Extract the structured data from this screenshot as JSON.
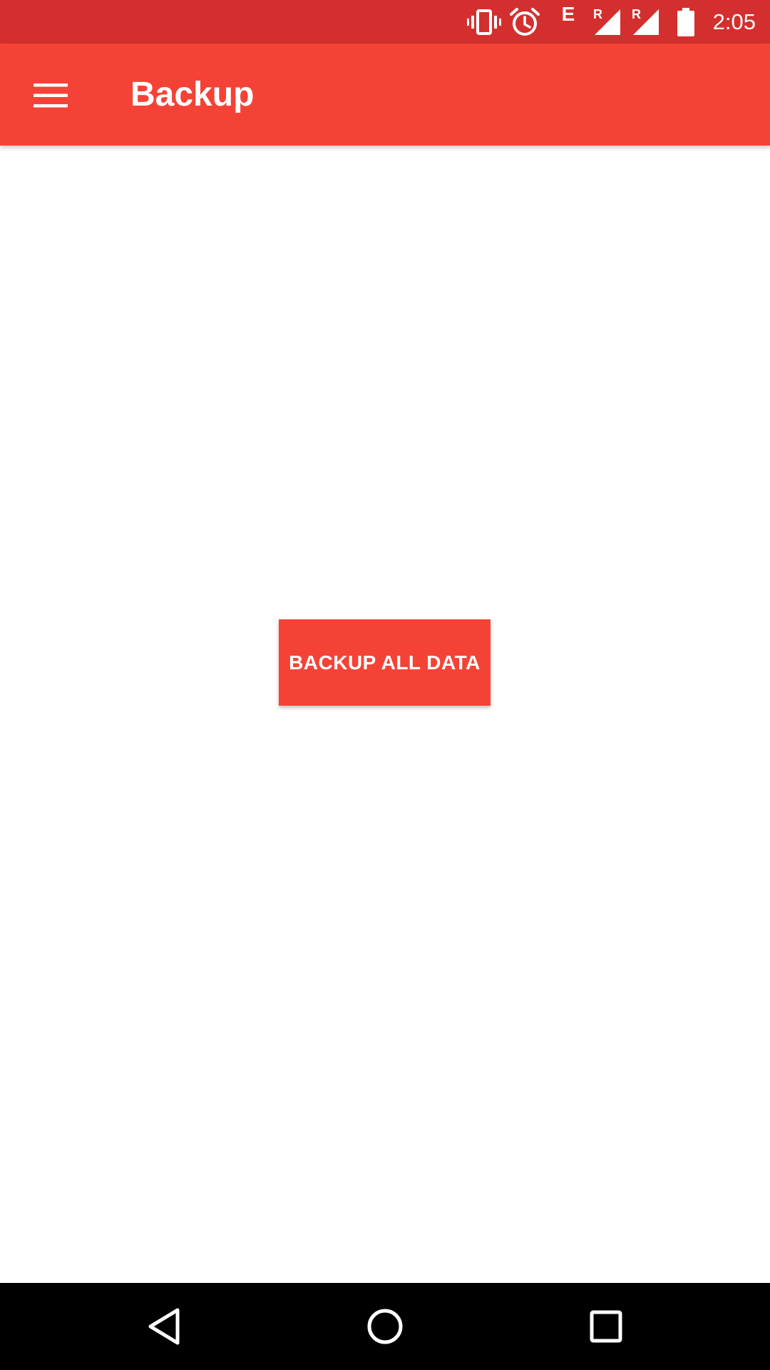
{
  "status_bar": {
    "time": "2:05",
    "icons": [
      "vibrate-icon",
      "alarm-icon",
      "edge-network-icon",
      "roaming-signal-icon",
      "roaming-signal-icon",
      "battery-icon"
    ],
    "network_label": "E",
    "roaming_label": "R",
    "background_color": "#d32f2f"
  },
  "app_bar": {
    "title": "Backup",
    "menu_icon": "hamburger-menu-icon",
    "background_color": "#f44336"
  },
  "main": {
    "backup_button_label": "BACKUP ALL DATA",
    "button_color": "#f44336"
  },
  "nav_bar": {
    "buttons": [
      "back-icon",
      "home-icon",
      "recents-icon"
    ]
  }
}
